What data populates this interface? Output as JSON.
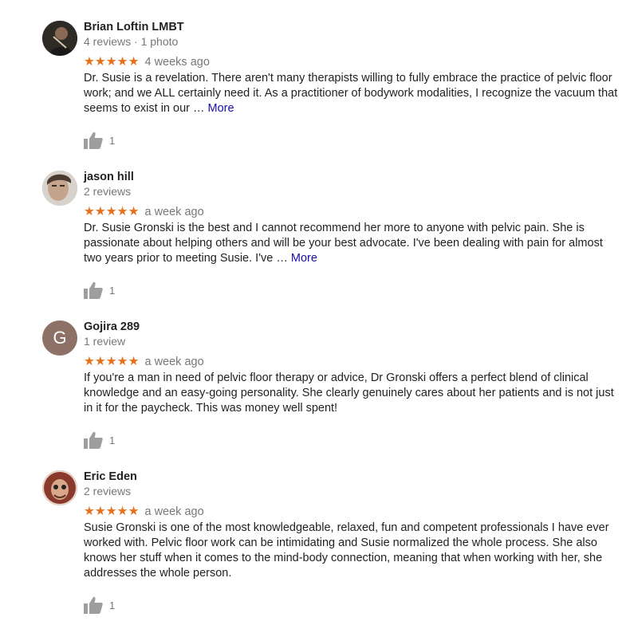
{
  "reviews": [
    {
      "name": "Brian Loftin LMBT",
      "meta": "4 reviews · 1 photo",
      "stars": "★★★★★",
      "ago": "4 weeks ago",
      "text": "Dr. Susie is a revelation. There aren't many therapists willing to fully embrace the practice of pelvic floor work; and we ALL certainly need it. As a practitioner of bodywork modalities, I recognize the vacuum that seems to exist in our … ",
      "more": "More",
      "likes": "1",
      "avatar_icon": "profile-photo-icon",
      "avatar_color": "#3a3632"
    },
    {
      "name": "jason hill",
      "meta": "2 reviews",
      "stars": "★★★★★",
      "ago": "a week ago",
      "text": "Dr. Susie Gronski is the best and I cannot recommend her more to anyone with pelvic pain. She is passionate about helping others and will be your best advocate. I've been dealing with pain for almost two years prior to meeting Susie. I've … ",
      "more": "More",
      "likes": "1",
      "avatar_icon": "profile-photo-icon",
      "avatar_color": "#b9a79b"
    },
    {
      "name": "Gojira 289",
      "meta": "1 review",
      "stars": "★★★★★",
      "ago": "a week ago",
      "text": "If you're a man in need of pelvic floor therapy or advice, Dr Gronski offers a perfect blend of clinical knowledge and an easy-going personality. She clearly genuinely cares about her patients and is not just in it for the paycheck. This was money well spent!",
      "more": "",
      "likes": "1",
      "avatar_letter": "G",
      "avatar_color": "#8d7166"
    },
    {
      "name": "Eric Eden",
      "meta": "2 reviews",
      "stars": "★★★★★",
      "ago": "a week ago",
      "text": "Susie Gronski is one of the most knowledgeable, relaxed, fun and competent professionals I have ever worked with.  Pelvic floor work can be intimidating and Susie normalized the whole process.  She also knows her stuff when it comes to the mind-body connection, meaning that when working with her, she addresses the whole person.",
      "more": "",
      "likes": "1",
      "avatar_icon": "profile-photo-icon",
      "avatar_color": "#7a4a3c"
    }
  ],
  "colors": {
    "star": "#e7711b",
    "more_link": "#1a0dab",
    "secondary_text": "#777777",
    "thumb": "#9e9e9e"
  },
  "icons": {
    "thumb": "thumbs-up-icon",
    "star": "star-icon"
  }
}
